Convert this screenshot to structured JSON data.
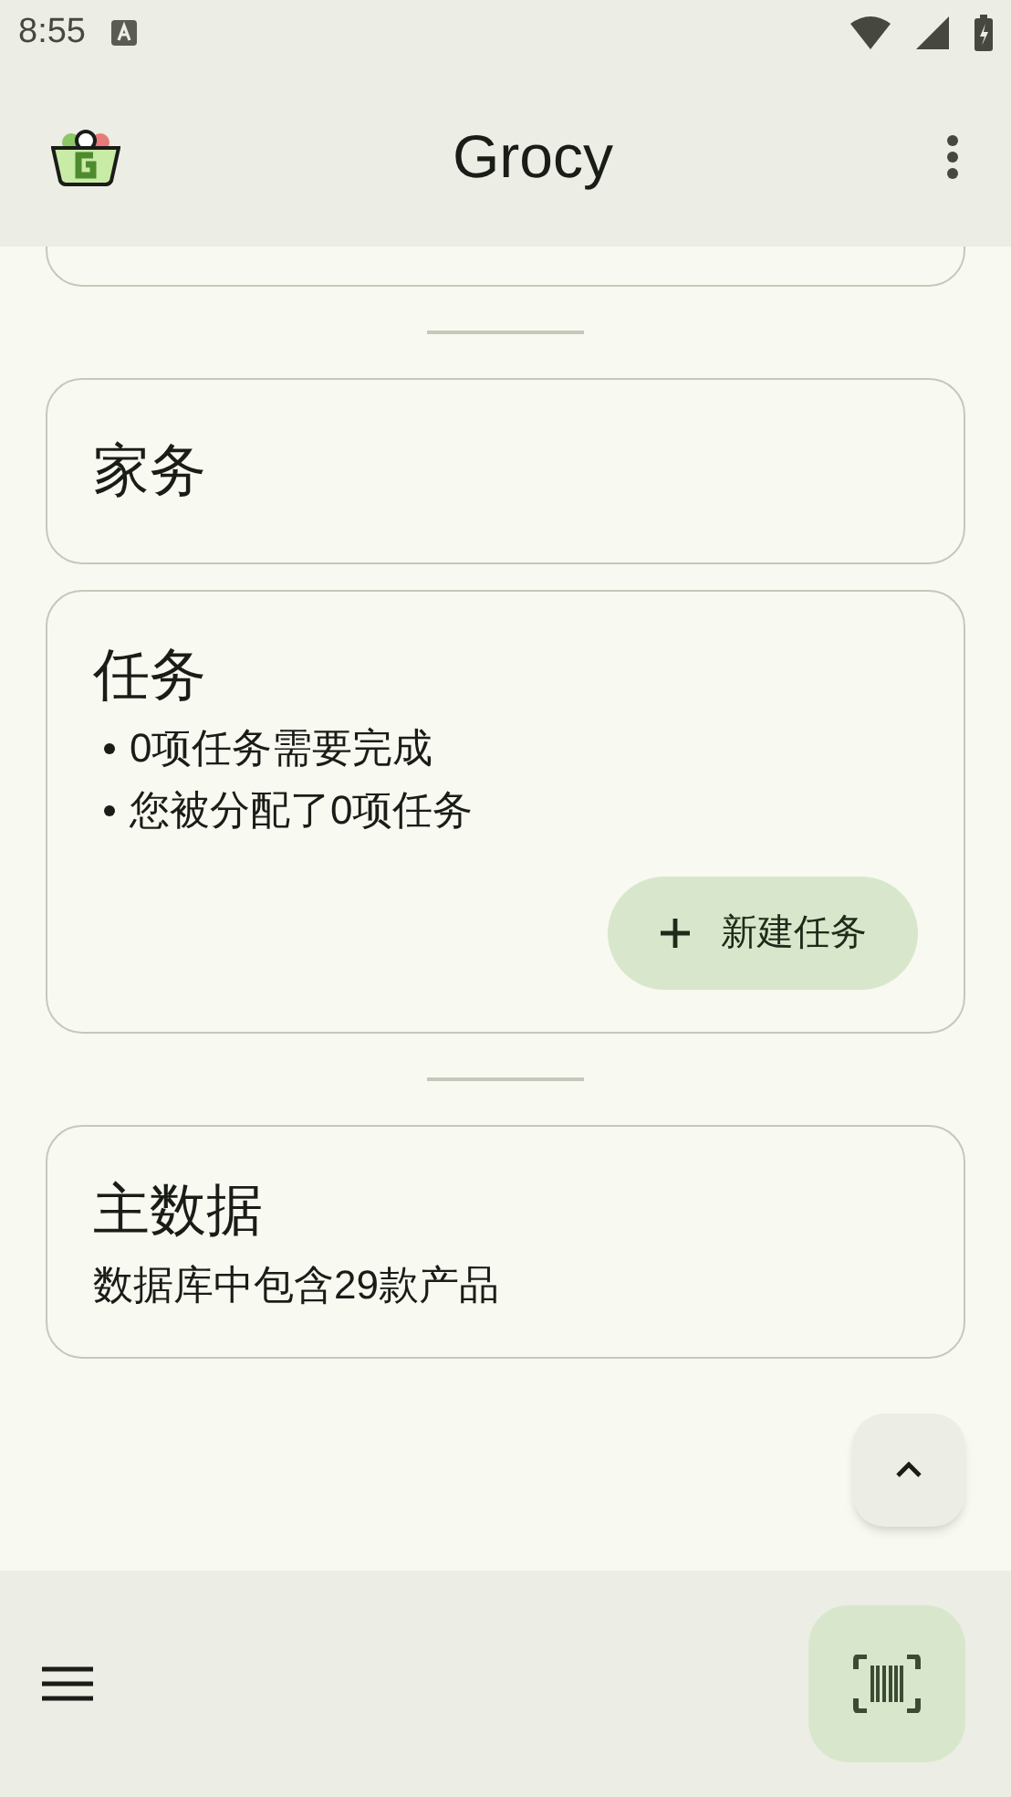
{
  "status_bar": {
    "time": "8:55"
  },
  "app_bar": {
    "title": "Grocy"
  },
  "cards": [
    {
      "kind": "cut"
    },
    {
      "kind": "title",
      "title": "家务"
    },
    {
      "kind": "list",
      "title": "任务",
      "items": [
        "0项任务需要完成",
        "您被分配了0项任务"
      ],
      "button": "新建任务"
    },
    {
      "kind": "text",
      "title": "主数据",
      "text": "数据库中包含29款产品"
    }
  ]
}
